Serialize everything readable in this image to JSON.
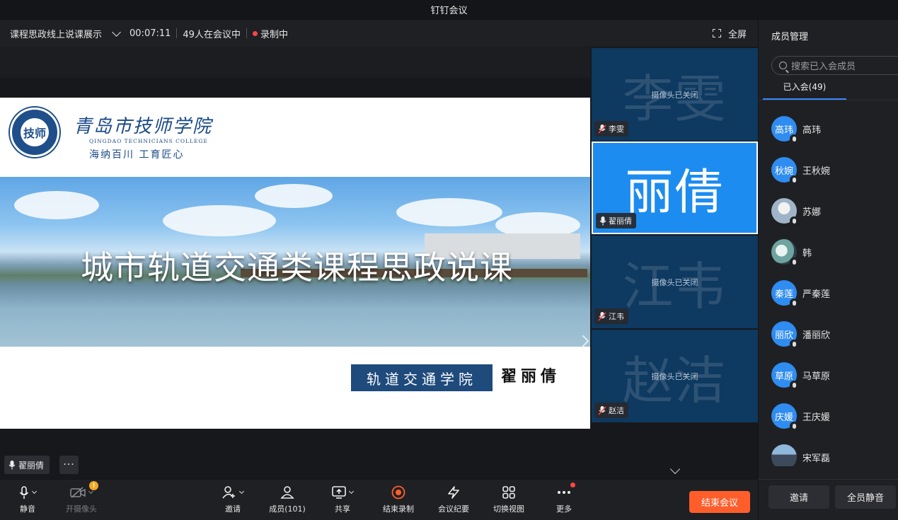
{
  "window": {
    "title": "钉钉会议"
  },
  "infobar": {
    "topic": "课程思政线上说课展示",
    "duration": "00:07:11",
    "participants": "49人在会议中",
    "recording": "录制中",
    "fullscreen": "全屏"
  },
  "slide": {
    "school_cn": "青岛市技师学院",
    "school_en": "QINGDAO TECHNICIANS COLLEGE",
    "motto": "海纳百川 工育匠心",
    "logo_text": "技师",
    "title": "城市轨道交通类课程思政说课",
    "department": "轨道交通学院",
    "presenter": "翟丽倩"
  },
  "speaker_chip": {
    "name": "翟丽倩",
    "more": "···"
  },
  "video_tiles": [
    {
      "big": "李雯",
      "status": "摄像头已关闭",
      "name": "李雯"
    },
    {
      "big": "丽倩",
      "status": "",
      "name": "翟丽倩"
    },
    {
      "big": "江韦",
      "status": "摄像头已关闭",
      "name": "江韦"
    },
    {
      "big": "赵洁",
      "status": "摄像头已关闭",
      "name": "赵洁"
    }
  ],
  "panel": {
    "title": "成员管理",
    "search_placeholder": "搜索已入会成员",
    "tab_joined": "已入会(49)",
    "members": [
      {
        "avatar": "高玮",
        "name": "高玮"
      },
      {
        "avatar": "秋婉",
        "name": "王秋婉"
      },
      {
        "avatar": "",
        "name": "苏娜"
      },
      {
        "avatar": "",
        "name": "韩"
      },
      {
        "avatar": "秦莲",
        "name": "严秦莲"
      },
      {
        "avatar": "丽欣",
        "name": "潘丽欣"
      },
      {
        "avatar": "草原",
        "name": "马草原"
      },
      {
        "avatar": "庆媛",
        "name": "王庆媛"
      },
      {
        "avatar": "",
        "name": "宋军磊"
      }
    ],
    "invite": "邀请",
    "mute_all": "全员静音"
  },
  "toolbar": {
    "mute": "静音",
    "camera": "开摄像头",
    "invite": "邀请",
    "members": "成员(101)",
    "share": "共享",
    "stop_record": "结束录制",
    "minutes": "会议纪要",
    "switch_view": "切换视图",
    "more": "更多",
    "end_meeting": "结束会议"
  },
  "colors": {
    "accent": "#1d8cf0",
    "end": "#ff5e2b",
    "tile": "#0e3960",
    "record": "#ff4545"
  }
}
